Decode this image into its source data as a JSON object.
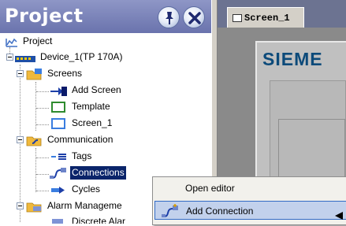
{
  "pane": {
    "title": "Project"
  },
  "tree": {
    "root": "Project",
    "device": "Device_1(TP 170A)",
    "screens": "Screens",
    "add_screen": "Add Screen",
    "template": "Template",
    "screen_1": "Screen_1",
    "communication": "Communication",
    "tags": "Tags",
    "connections": "Connections",
    "cycles": "Cycles",
    "alarm_management": "Alarm Manageme",
    "discrete_alarms": "Discrete Alar"
  },
  "workspace": {
    "tab_label": "Screen_1",
    "brand": "SIEME"
  },
  "context_menu": {
    "open_editor": "Open editor",
    "add_connection": "Add Connection"
  },
  "colors": {
    "header": "#6a73ad",
    "selection": "#0a246a",
    "menu_highlight": "#c2d1ec",
    "brand": "#0c4a7a"
  },
  "icons": {
    "pin": "pin-icon",
    "close": "close-icon"
  }
}
